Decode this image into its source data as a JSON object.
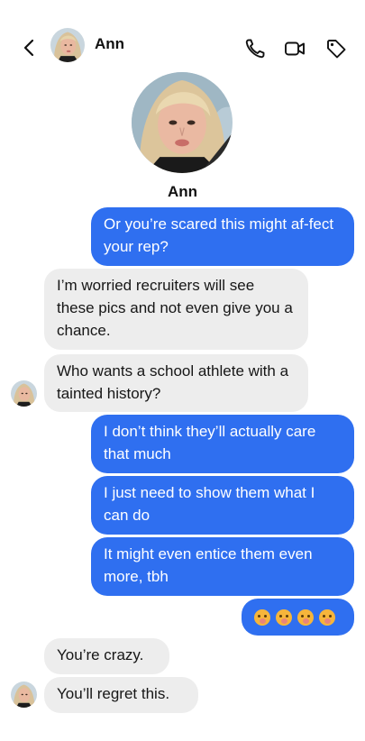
{
  "header": {
    "contact_name": "Ann",
    "icons": [
      "back-chevron-icon",
      "phone-icon",
      "video-camera-icon",
      "tag-icon"
    ]
  },
  "profile": {
    "name": "Ann"
  },
  "messages": [
    {
      "sender": "me",
      "text": "Or you’re scared this might af-fect your rep?"
    },
    {
      "sender": "ann",
      "text": "I’m worried recruiters will see these pics and not even give you a chance."
    },
    {
      "sender": "ann",
      "text": "Who wants a school athlete with a tainted history?"
    },
    {
      "sender": "me",
      "text": "I don’t think they’ll actually care that much"
    },
    {
      "sender": "me",
      "text": "I just need to show them what I can do"
    },
    {
      "sender": "me",
      "text": "It might even entice them even more, tbh"
    },
    {
      "sender": "me",
      "text": "🤭🤭🤭🤭"
    },
    {
      "sender": "ann",
      "text": "You’re crazy."
    },
    {
      "sender": "ann",
      "text": "You’ll regret this."
    }
  ],
  "colors": {
    "outgoing_bubble": "#2f6ff0",
    "incoming_bubble": "#ededed",
    "background": "#ffffff"
  }
}
